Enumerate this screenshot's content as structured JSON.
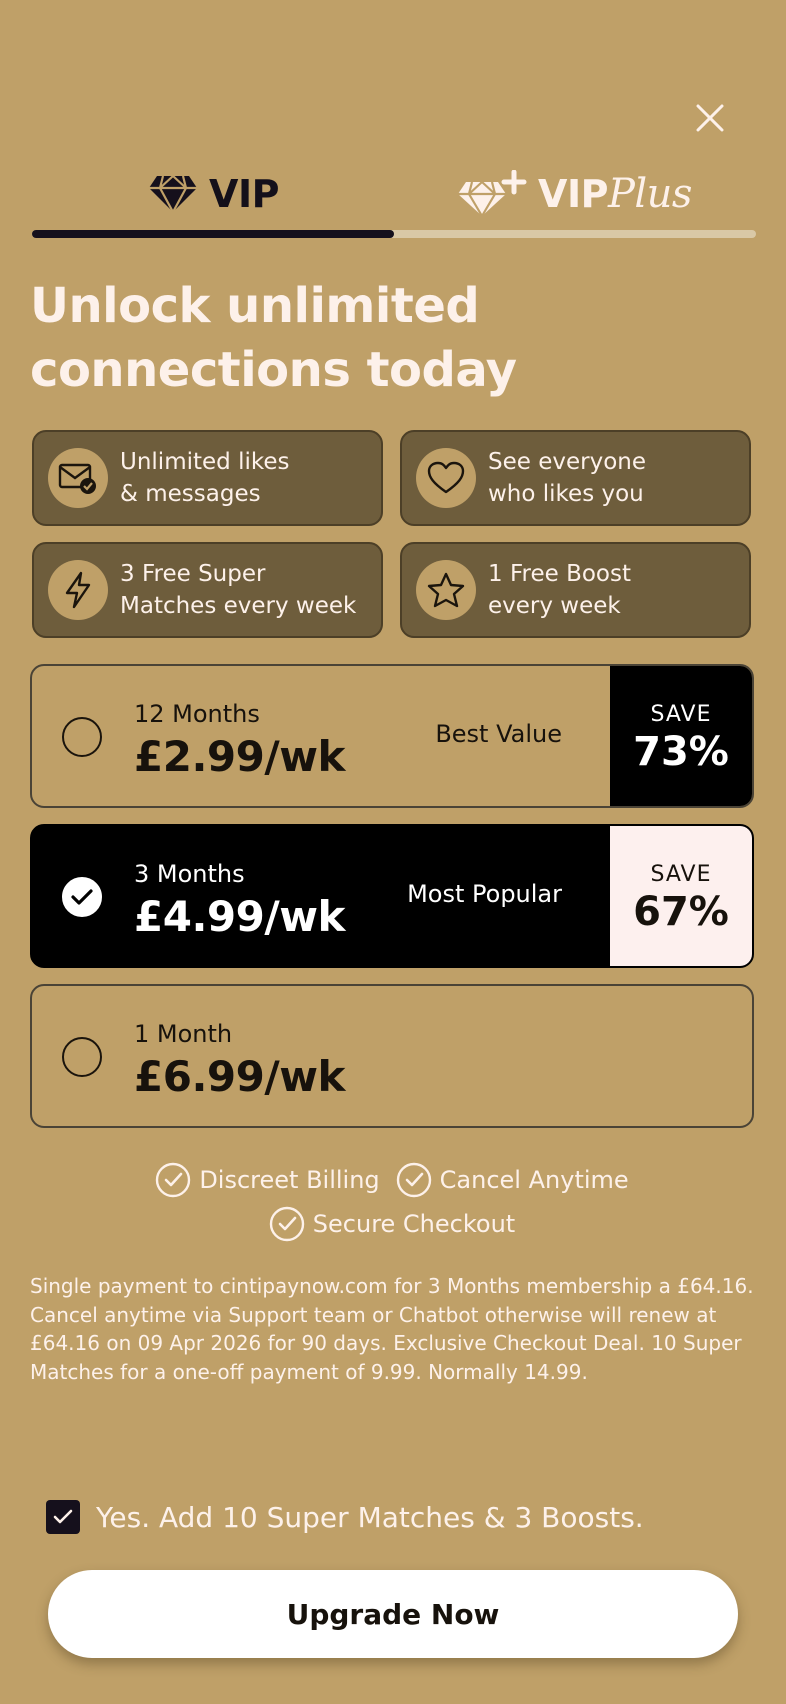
{
  "header": {
    "close_icon": "close-icon"
  },
  "tabs": [
    {
      "label": "VIP",
      "icon": "diamond-icon",
      "active": true
    },
    {
      "label": "VIP",
      "label_suffix": "Plus",
      "icon": "diamond-plus-icon",
      "active": false
    }
  ],
  "headline": "Unlock unlimited connections today",
  "features": [
    {
      "icon": "envelope-check-icon",
      "line1": "Unlimited likes",
      "line2": "& messages"
    },
    {
      "icon": "heart-icon",
      "line1": "See everyone",
      "line2": "who likes you"
    },
    {
      "icon": "lightning-icon",
      "line1": "3 Free Super",
      "line2": "Matches every week"
    },
    {
      "icon": "star-icon",
      "line1": "1 Free Boost",
      "line2": "every week"
    }
  ],
  "plans": [
    {
      "duration": "12 Months",
      "price": "£2.99/wk",
      "badge": "Best Value",
      "save_label": "SAVE",
      "save_value": "73%",
      "selected": false
    },
    {
      "duration": "3 Months",
      "price": "£4.99/wk",
      "badge": "Most Popular",
      "save_label": "SAVE",
      "save_value": "67%",
      "selected": true
    },
    {
      "duration": "1 Month",
      "price": "£6.99/wk",
      "selected": false
    }
  ],
  "assurances": [
    "Discreet Billing",
    "Cancel Anytime",
    "Secure Checkout"
  ],
  "terms": "Single payment to cintipaynow.com for 3 Months membership a £64.16. Cancel anytime via Support team or Chatbot otherwise will renew at £64.16 on 09 Apr 2026  for 90 days. Exclusive Checkout Deal. 10 Super Matches for a one-off payment of 9.99. Normally 14.99.",
  "addon": {
    "label": "Yes. Add 10 Super Matches & 3 Boosts.",
    "checked": true
  },
  "cta": {
    "label": "Upgrade Now"
  },
  "colors": {
    "background": "#BFA068",
    "feature_card": "#6e5d3c",
    "dark": "#15101c",
    "light_text": "#fdf1ea"
  }
}
